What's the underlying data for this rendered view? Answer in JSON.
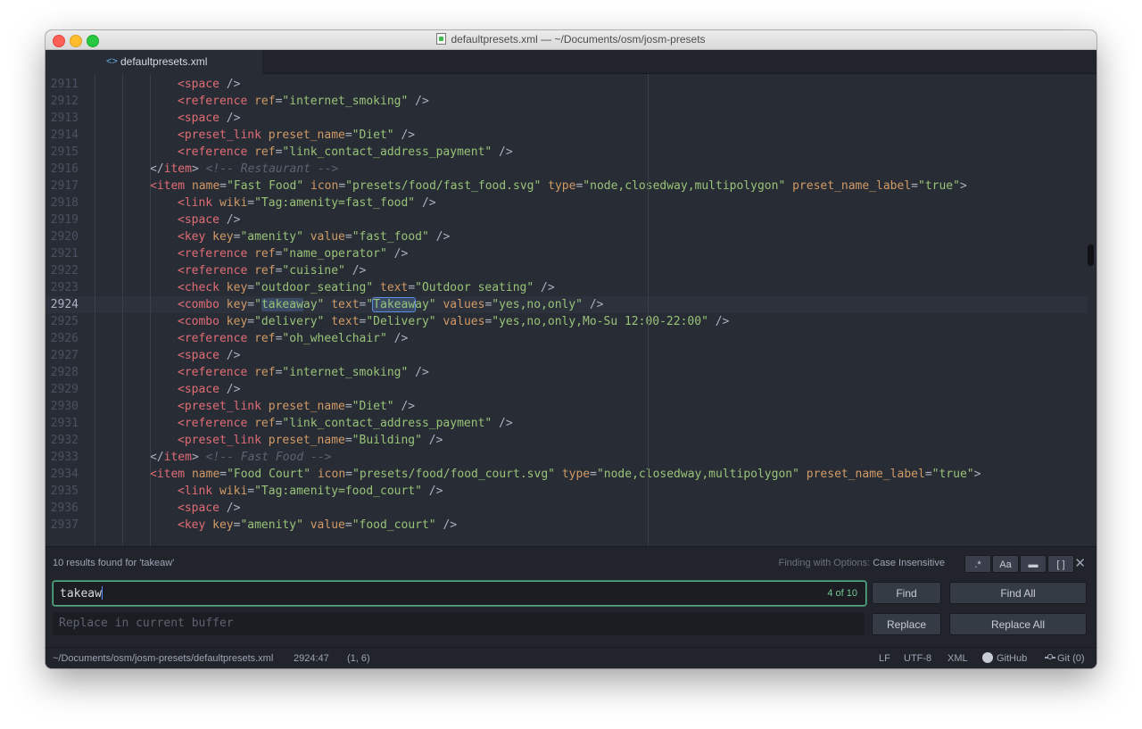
{
  "window": {
    "title": "defaultpresets.xml — ~/Documents/osm/josm-presets"
  },
  "tabs": [
    {
      "label": "defaultpresets.xml",
      "icon": "code-icon"
    }
  ],
  "editor": {
    "lines": [
      {
        "num": "2911",
        "indent": 3,
        "tokens": [
          [
            "tag",
            "<space"
          ],
          [
            "pun",
            " />"
          ]
        ]
      },
      {
        "num": "2912",
        "indent": 3,
        "tokens": [
          [
            "tag",
            "<reference"
          ],
          [
            "pun",
            " "
          ],
          [
            "attr",
            "ref"
          ],
          [
            "pun",
            "="
          ],
          [
            "str",
            "\"internet_smoking\""
          ],
          [
            "pun",
            " />"
          ]
        ]
      },
      {
        "num": "2913",
        "indent": 3,
        "tokens": [
          [
            "tag",
            "<space"
          ],
          [
            "pun",
            " />"
          ]
        ]
      },
      {
        "num": "2914",
        "indent": 3,
        "tokens": [
          [
            "tag",
            "<preset_link"
          ],
          [
            "pun",
            " "
          ],
          [
            "attr",
            "preset_name"
          ],
          [
            "pun",
            "="
          ],
          [
            "str",
            "\"Diet\""
          ],
          [
            "pun",
            " />"
          ]
        ]
      },
      {
        "num": "2915",
        "indent": 3,
        "tokens": [
          [
            "tag",
            "<reference"
          ],
          [
            "pun",
            " "
          ],
          [
            "attr",
            "ref"
          ],
          [
            "pun",
            "="
          ],
          [
            "str",
            "\"link_contact_address_payment\""
          ],
          [
            "pun",
            " />"
          ]
        ]
      },
      {
        "num": "2916",
        "indent": 2,
        "tokens": [
          [
            "pun",
            "</"
          ],
          [
            "tag",
            "item"
          ],
          [
            "pun",
            "> "
          ],
          [
            "cmt",
            "<!-- Restaurant -->"
          ]
        ]
      },
      {
        "num": "2917",
        "indent": 2,
        "tokens": [
          [
            "tag",
            "<item"
          ],
          [
            "pun",
            " "
          ],
          [
            "attr",
            "name"
          ],
          [
            "pun",
            "="
          ],
          [
            "str",
            "\"Fast Food\""
          ],
          [
            "pun",
            " "
          ],
          [
            "attr",
            "icon"
          ],
          [
            "pun",
            "="
          ],
          [
            "str",
            "\"presets/food/fast_food.svg\""
          ],
          [
            "pun",
            " "
          ],
          [
            "attr",
            "type"
          ],
          [
            "pun",
            "="
          ],
          [
            "str",
            "\"node,closedway,multipolygon\""
          ],
          [
            "pun",
            " "
          ],
          [
            "attr",
            "preset_name_label"
          ],
          [
            "pun",
            "="
          ],
          [
            "str",
            "\"true\""
          ],
          [
            "pun",
            ">"
          ]
        ]
      },
      {
        "num": "2918",
        "indent": 3,
        "tokens": [
          [
            "tag",
            "<link"
          ],
          [
            "pun",
            " "
          ],
          [
            "attr",
            "wiki"
          ],
          [
            "pun",
            "="
          ],
          [
            "str",
            "\"Tag:amenity=fast_food\""
          ],
          [
            "pun",
            " />"
          ]
        ]
      },
      {
        "num": "2919",
        "indent": 3,
        "tokens": [
          [
            "tag",
            "<space"
          ],
          [
            "pun",
            " />"
          ]
        ]
      },
      {
        "num": "2920",
        "indent": 3,
        "tokens": [
          [
            "tag",
            "<key"
          ],
          [
            "pun",
            " "
          ],
          [
            "attr",
            "key"
          ],
          [
            "pun",
            "="
          ],
          [
            "str",
            "\"amenity\""
          ],
          [
            "pun",
            " "
          ],
          [
            "attr",
            "value"
          ],
          [
            "pun",
            "="
          ],
          [
            "str",
            "\"fast_food\""
          ],
          [
            "pun",
            " />"
          ]
        ]
      },
      {
        "num": "2921",
        "indent": 3,
        "tokens": [
          [
            "tag",
            "<reference"
          ],
          [
            "pun",
            " "
          ],
          [
            "attr",
            "ref"
          ],
          [
            "pun",
            "="
          ],
          [
            "str",
            "\"name_operator\""
          ],
          [
            "pun",
            " />"
          ]
        ]
      },
      {
        "num": "2922",
        "indent": 3,
        "tokens": [
          [
            "tag",
            "<reference"
          ],
          [
            "pun",
            " "
          ],
          [
            "attr",
            "ref"
          ],
          [
            "pun",
            "="
          ],
          [
            "str",
            "\"cuisine\""
          ],
          [
            "pun",
            " />"
          ]
        ]
      },
      {
        "num": "2923",
        "indent": 3,
        "tokens": [
          [
            "tag",
            "<check"
          ],
          [
            "pun",
            " "
          ],
          [
            "attr",
            "key"
          ],
          [
            "pun",
            "="
          ],
          [
            "str",
            "\"outdoor_seating\""
          ],
          [
            "pun",
            " "
          ],
          [
            "attr",
            "text"
          ],
          [
            "pun",
            "="
          ],
          [
            "str",
            "\"Outdoor seating\""
          ],
          [
            "pun",
            " />"
          ]
        ]
      },
      {
        "num": "2924",
        "indent": 3,
        "current": true,
        "tokens": [
          [
            "tag",
            "<combo"
          ],
          [
            "pun",
            " "
          ],
          [
            "attr",
            "key"
          ],
          [
            "pun",
            "="
          ],
          [
            "str",
            "\""
          ],
          [
            "hl",
            "takeaw"
          ],
          [
            "str",
            "ay\""
          ],
          [
            "pun",
            " "
          ],
          [
            "attr",
            "text"
          ],
          [
            "pun",
            "="
          ],
          [
            "str",
            "\""
          ],
          [
            "hlcur",
            "Takeaw"
          ],
          [
            "str",
            "ay\""
          ],
          [
            "pun",
            " "
          ],
          [
            "attr",
            "values"
          ],
          [
            "pun",
            "="
          ],
          [
            "str",
            "\"yes,no,only\""
          ],
          [
            "pun",
            " />"
          ]
        ]
      },
      {
        "num": "2925",
        "indent": 3,
        "tokens": [
          [
            "tag",
            "<combo"
          ],
          [
            "pun",
            " "
          ],
          [
            "attr",
            "key"
          ],
          [
            "pun",
            "="
          ],
          [
            "str",
            "\"delivery\""
          ],
          [
            "pun",
            " "
          ],
          [
            "attr",
            "text"
          ],
          [
            "pun",
            "="
          ],
          [
            "str",
            "\"Delivery\""
          ],
          [
            "pun",
            " "
          ],
          [
            "attr",
            "values"
          ],
          [
            "pun",
            "="
          ],
          [
            "str",
            "\"yes,no,only,Mo-Su 12:00-22:00\""
          ],
          [
            "pun",
            " />"
          ]
        ]
      },
      {
        "num": "2926",
        "indent": 3,
        "tokens": [
          [
            "tag",
            "<reference"
          ],
          [
            "pun",
            " "
          ],
          [
            "attr",
            "ref"
          ],
          [
            "pun",
            "="
          ],
          [
            "str",
            "\"oh_wheelchair\""
          ],
          [
            "pun",
            " />"
          ]
        ]
      },
      {
        "num": "2927",
        "indent": 3,
        "tokens": [
          [
            "tag",
            "<space"
          ],
          [
            "pun",
            " />"
          ]
        ]
      },
      {
        "num": "2928",
        "indent": 3,
        "tokens": [
          [
            "tag",
            "<reference"
          ],
          [
            "pun",
            " "
          ],
          [
            "attr",
            "ref"
          ],
          [
            "pun",
            "="
          ],
          [
            "str",
            "\"internet_smoking\""
          ],
          [
            "pun",
            " />"
          ]
        ]
      },
      {
        "num": "2929",
        "indent": 3,
        "tokens": [
          [
            "tag",
            "<space"
          ],
          [
            "pun",
            " />"
          ]
        ]
      },
      {
        "num": "2930",
        "indent": 3,
        "tokens": [
          [
            "tag",
            "<preset_link"
          ],
          [
            "pun",
            " "
          ],
          [
            "attr",
            "preset_name"
          ],
          [
            "pun",
            "="
          ],
          [
            "str",
            "\"Diet\""
          ],
          [
            "pun",
            " />"
          ]
        ]
      },
      {
        "num": "2931",
        "indent": 3,
        "tokens": [
          [
            "tag",
            "<reference"
          ],
          [
            "pun",
            " "
          ],
          [
            "attr",
            "ref"
          ],
          [
            "pun",
            "="
          ],
          [
            "str",
            "\"link_contact_address_payment\""
          ],
          [
            "pun",
            " />"
          ]
        ]
      },
      {
        "num": "2932",
        "indent": 3,
        "tokens": [
          [
            "tag",
            "<preset_link"
          ],
          [
            "pun",
            " "
          ],
          [
            "attr",
            "preset_name"
          ],
          [
            "pun",
            "="
          ],
          [
            "str",
            "\"Building\""
          ],
          [
            "pun",
            " />"
          ]
        ]
      },
      {
        "num": "2933",
        "indent": 2,
        "tokens": [
          [
            "pun",
            "</"
          ],
          [
            "tag",
            "item"
          ],
          [
            "pun",
            "> "
          ],
          [
            "cmt",
            "<!-- Fast Food -->"
          ]
        ]
      },
      {
        "num": "2934",
        "indent": 2,
        "tokens": [
          [
            "tag",
            "<item"
          ],
          [
            "pun",
            " "
          ],
          [
            "attr",
            "name"
          ],
          [
            "pun",
            "="
          ],
          [
            "str",
            "\"Food Court\""
          ],
          [
            "pun",
            " "
          ],
          [
            "attr",
            "icon"
          ],
          [
            "pun",
            "="
          ],
          [
            "str",
            "\"presets/food/food_court.svg\""
          ],
          [
            "pun",
            " "
          ],
          [
            "attr",
            "type"
          ],
          [
            "pun",
            "="
          ],
          [
            "str",
            "\"node,closedway,multipolygon\""
          ],
          [
            "pun",
            " "
          ],
          [
            "attr",
            "preset_name_label"
          ],
          [
            "pun",
            "="
          ],
          [
            "str",
            "\"true\""
          ],
          [
            "pun",
            ">"
          ]
        ]
      },
      {
        "num": "2935",
        "indent": 3,
        "tokens": [
          [
            "tag",
            "<link"
          ],
          [
            "pun",
            " "
          ],
          [
            "attr",
            "wiki"
          ],
          [
            "pun",
            "="
          ],
          [
            "str",
            "\"Tag:amenity=food_court\""
          ],
          [
            "pun",
            " />"
          ]
        ]
      },
      {
        "num": "2936",
        "indent": 3,
        "tokens": [
          [
            "tag",
            "<space"
          ],
          [
            "pun",
            " />"
          ]
        ]
      },
      {
        "num": "2937",
        "indent": 3,
        "tokens": [
          [
            "tag",
            "<key"
          ],
          [
            "pun",
            " "
          ],
          [
            "attr",
            "key"
          ],
          [
            "pun",
            "="
          ],
          [
            "str",
            "\"amenity\""
          ],
          [
            "pun",
            " "
          ],
          [
            "attr",
            "value"
          ],
          [
            "pun",
            "="
          ],
          [
            "str",
            "\"food_court\""
          ],
          [
            "pun",
            " />"
          ]
        ]
      }
    ]
  },
  "find": {
    "results_text": "10 results found for 'takeaw'",
    "options_prefix": "Finding with Options:",
    "options_value": "Case Insensitive",
    "option_buttons": [
      {
        "label": ".*",
        "icon": "regex-icon"
      },
      {
        "label": "Aa",
        "icon": "case-icon"
      },
      {
        "label": "▬",
        "icon": "selection-icon"
      },
      {
        "label": "[ ]",
        "icon": "whole-word-icon"
      }
    ],
    "close_label": "✕",
    "query": "takeaw",
    "count": "4 of 10",
    "replace_placeholder": "Replace in current buffer",
    "find_label": "Find",
    "find_all_label": "Find All",
    "replace_label": "Replace",
    "replace_all_label": "Replace All"
  },
  "status": {
    "path": "~/Documents/osm/josm-presets/defaultpresets.xml",
    "cursor": "2924:47",
    "selection": "(1, 6)",
    "line_ending": "LF",
    "encoding": "UTF-8",
    "grammar": "XML",
    "github": "GitHub",
    "git": "Git (0)"
  }
}
